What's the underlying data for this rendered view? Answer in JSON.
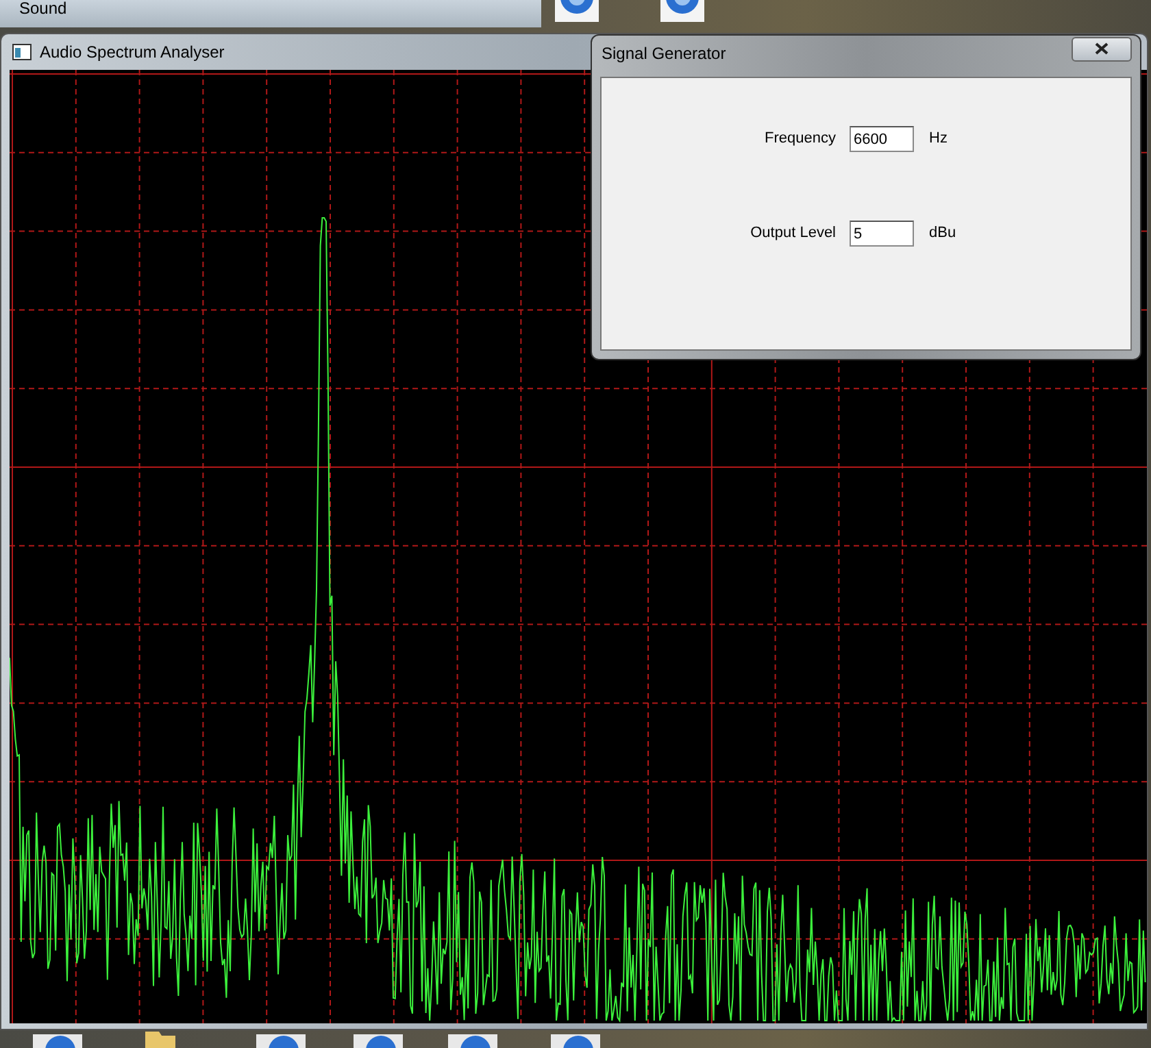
{
  "background_window": {
    "title": "Sound"
  },
  "spectrum_window": {
    "title": "Audio Spectrum Analyser"
  },
  "signal_generator": {
    "title": "Signal Generator",
    "fields": [
      {
        "label": "Frequency",
        "value": "6600",
        "unit": "Hz"
      },
      {
        "label": "Output Level",
        "value": "5",
        "unit": "dBu"
      }
    ]
  }
}
